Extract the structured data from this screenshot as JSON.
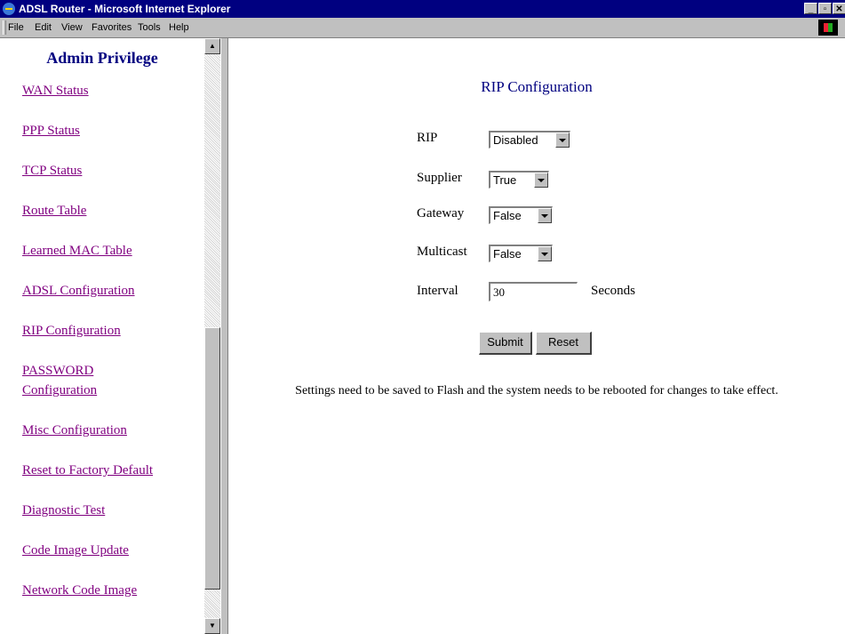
{
  "window": {
    "title": "ADSL Router - Microsoft Internet Explorer"
  },
  "menu": {
    "items": [
      "File",
      "Edit",
      "View",
      "Favorites",
      "Tools",
      "Help"
    ]
  },
  "sidebar": {
    "heading": "Admin Privilege",
    "links": [
      [
        "WAN Status"
      ],
      [
        "PPP Status"
      ],
      [
        "TCP Status"
      ],
      [
        "Route Table"
      ],
      [
        "Learned MAC Table"
      ],
      [
        "ADSL Configuration"
      ],
      [
        "RIP Configuration"
      ],
      [
        "PASSWORD",
        "Configuration"
      ],
      [
        "Misc Configuration"
      ],
      [
        "Reset to Factory Default"
      ],
      [
        "Diagnostic Test"
      ],
      [
        "Code Image Update"
      ],
      [
        "Network Code Image"
      ]
    ]
  },
  "form": {
    "heading": "RIP Configuration",
    "rip": {
      "label": "RIP",
      "value": "Disabled"
    },
    "supplier": {
      "label": "Supplier",
      "value": "True"
    },
    "gateway": {
      "label": "Gateway",
      "value": "False"
    },
    "multicast": {
      "label": "Multicast",
      "value": "False"
    },
    "interval": {
      "label": "Interval",
      "value": "30",
      "unit": "Seconds"
    },
    "submit_label": "Submit",
    "reset_label": "Reset",
    "note": "Settings need to be saved to Flash and the system needs to be rebooted for changes to take effect."
  }
}
